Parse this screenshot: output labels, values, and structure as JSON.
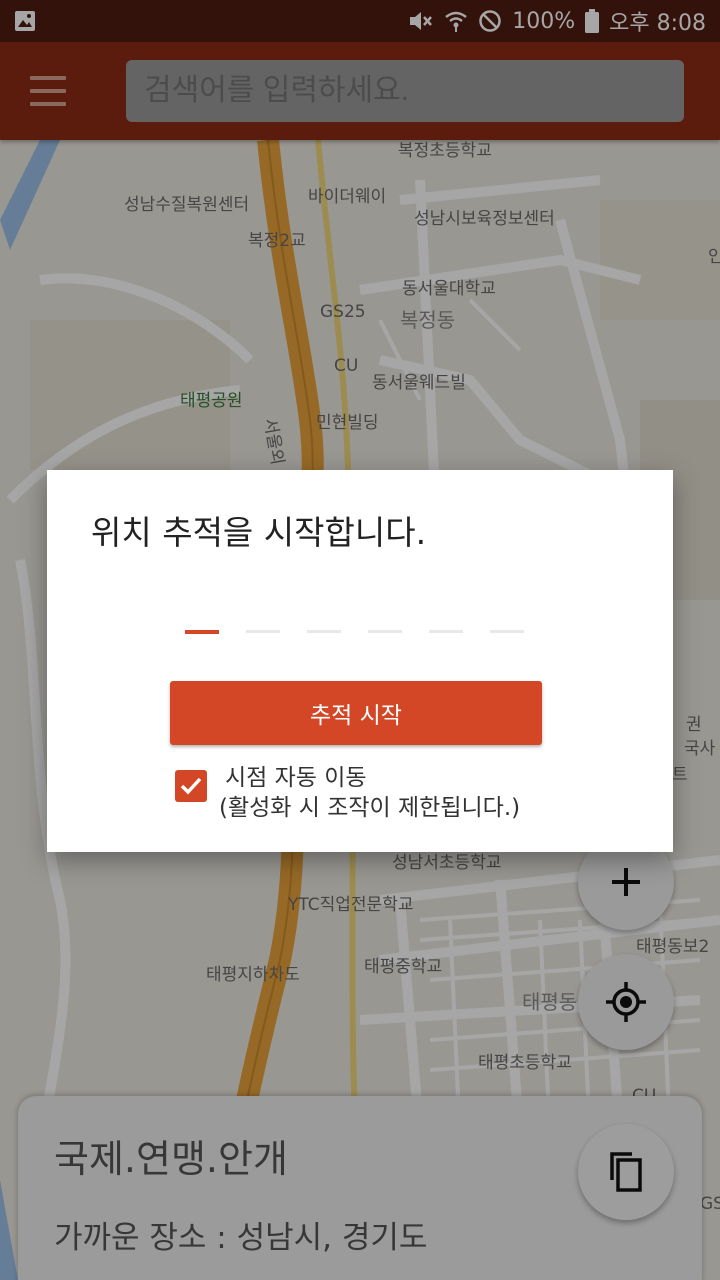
{
  "status_bar": {
    "battery_percent": "100%",
    "time": "오후 8:08",
    "icons": [
      "image-notification-icon",
      "mute-icon",
      "wifi-icon",
      "do-not-disturb-icon",
      "battery-icon"
    ]
  },
  "app_bar": {
    "menu_icon": "hamburger-menu-icon",
    "search_placeholder": "검색어를 입력하세요."
  },
  "map": {
    "labels": [
      "복정초등학교",
      "바이더웨이",
      "성남수질복원센터",
      "성남시보육정보센터",
      "복정2교",
      "동서울대학교",
      "GS25",
      "복정동",
      "CU",
      "동서울웨드빌",
      "태평공원",
      "민현빌딩",
      "서울외",
      "YTC직업전문학교",
      "태평지하차도",
      "태평중학교",
      "태평동",
      "태평초등학교",
      "태평동보2",
      "성남서초등학교",
      "국사",
      "권",
      "트",
      "인",
      "CU",
      "GS"
    ],
    "colors": {
      "background": "#ece8e0",
      "highway": "#e9a23b",
      "road": "#ffffff",
      "river": "#9cc0e8"
    }
  },
  "dialog": {
    "title": "위치 추적을 시작합니다.",
    "code_slots": 6,
    "active_slot": 1,
    "start_button": "추적 시작",
    "checkbox_checked": true,
    "checkbox_label_line1": "시점 자동 이동",
    "checkbox_label_line2": "(활성화 시 조작이 제한됩니다.)"
  },
  "fabs": {
    "zoom_in_icon": "plus-icon",
    "my_location_icon": "my-location-icon",
    "copy_icon": "copy-icon"
  },
  "bottom_card": {
    "title": "국제.연맹.안개",
    "nearby": "가까운 장소 :  성남시, 경기도"
  },
  "colors": {
    "status_bar": "#4e1c10",
    "app_bar": "#8e2c14",
    "accent": "#d34726"
  }
}
